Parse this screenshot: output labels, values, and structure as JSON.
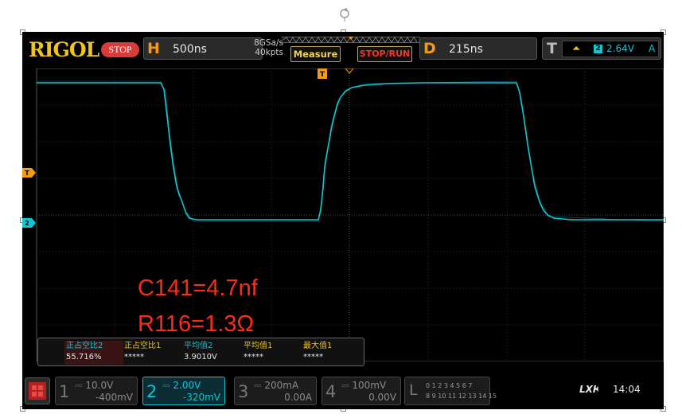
{
  "brand": "RIGOL",
  "run_state": "STOP",
  "horizontal": {
    "letter": "H",
    "timebase": "500ns",
    "sample_rate": "8GSa/s",
    "memory_depth": "40kpts"
  },
  "buttons": {
    "measure": "Measure",
    "stop_run": "STOP/RUN"
  },
  "delay": {
    "letter": "D",
    "value": "215ns"
  },
  "trigger": {
    "letter": "T",
    "source": "2",
    "level": "2.64V",
    "mode": "A"
  },
  "markers": {
    "trigger_pos": "T",
    "trigger_level": "T",
    "ch2_ground": "2"
  },
  "annotation": {
    "line1": "C141=4.7nf",
    "line2": "R116=1.3Ω"
  },
  "measurements": [
    {
      "label": "正占空比2",
      "value": "55.716%",
      "color": "#0fc6d4"
    },
    {
      "label": "正占空比1",
      "value": "*****",
      "color": "#f0c419"
    },
    {
      "label": "平均值2",
      "value": "3.9010V",
      "color": "#0fc6d4"
    },
    {
      "label": "平均值1",
      "value": "*****",
      "color": "#f0c419"
    },
    {
      "label": "最大值1",
      "value": "*****",
      "color": "#f0c419"
    }
  ],
  "channels": [
    {
      "num": "1",
      "scale": "10.0V",
      "offset": "-400mV"
    },
    {
      "num": "2",
      "scale": "2.00V",
      "offset": "-320mV"
    },
    {
      "num": "3",
      "scale": "200mA",
      "offset": "0.00A"
    },
    {
      "num": "4",
      "scale": "100mV",
      "offset": "0.00V"
    }
  ],
  "logic_analyzer": {
    "letter": "L",
    "row1": "0 1 2 3  4 5 6 7",
    "row2": "8 9 10 11 12 13 14 15"
  },
  "status": {
    "lxi": "LXI",
    "sound_icon": "speaker-muted-icon",
    "time": "14:04"
  },
  "colors": {
    "ch2": "#0fc6d4",
    "accent": "#f39c12",
    "annotation": "#ff2a1a",
    "stop": "#d93a3a"
  }
}
